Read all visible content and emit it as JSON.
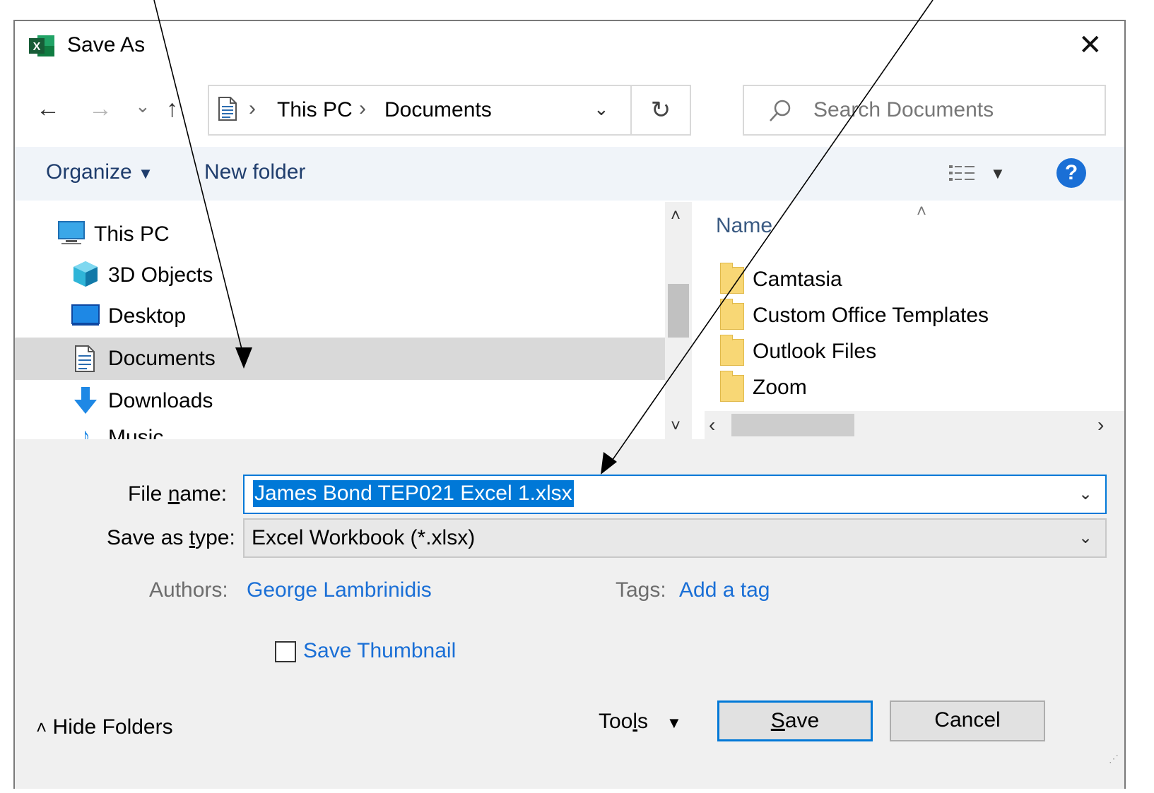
{
  "window": {
    "title": "Save As",
    "app_badge": "X"
  },
  "nav": {
    "back": "←",
    "forward": "→",
    "recent": "⌄",
    "up": "↑"
  },
  "address": {
    "segments": [
      "This PC",
      "Documents"
    ],
    "separator": "›"
  },
  "search": {
    "placeholder": "Search Documents"
  },
  "toolbar": {
    "organize": "Organize",
    "new_folder": "New folder",
    "help": "?"
  },
  "tree": [
    {
      "label": "This PC",
      "icon": "computer-icon"
    },
    {
      "label": "3D Objects",
      "icon": "cube-icon"
    },
    {
      "label": "Desktop",
      "icon": "desktop-icon"
    },
    {
      "label": "Documents",
      "icon": "document-icon",
      "selected": true
    },
    {
      "label": "Downloads",
      "icon": "download-arrow-icon"
    },
    {
      "label": "Music",
      "icon": "music-icon"
    }
  ],
  "files": {
    "column_header": "Name",
    "items": [
      "Camtasia",
      "Custom Office Templates",
      "Outlook Files",
      "Zoom"
    ]
  },
  "form": {
    "file_name_label_pre": "File ",
    "file_name_label_key": "n",
    "file_name_label_post": "ame:",
    "file_name_value": "James Bond TEP021 Excel 1.xlsx",
    "type_label_pre": "Save as ",
    "type_label_key": "t",
    "type_label_post": "ype:",
    "type_value": "Excel Workbook (*.xlsx)",
    "authors_label": "Authors:",
    "authors_value": "George Lambrinidis",
    "tags_label": "Tags:",
    "tags_value": "Add a tag",
    "thumbnail_label": "Save Thumbnail",
    "thumbnail_checked": false
  },
  "footer": {
    "hide_folders": "Hide Folders",
    "tools_pre": "Too",
    "tools_key": "l",
    "tools_post": "s",
    "save_key": "S",
    "save_rest": "ave",
    "cancel": "Cancel"
  },
  "colors": {
    "accent": "#0078d7",
    "link": "#1a6fd6",
    "selection_bg": "#0078d7",
    "excel_green": "#1d6f42"
  }
}
